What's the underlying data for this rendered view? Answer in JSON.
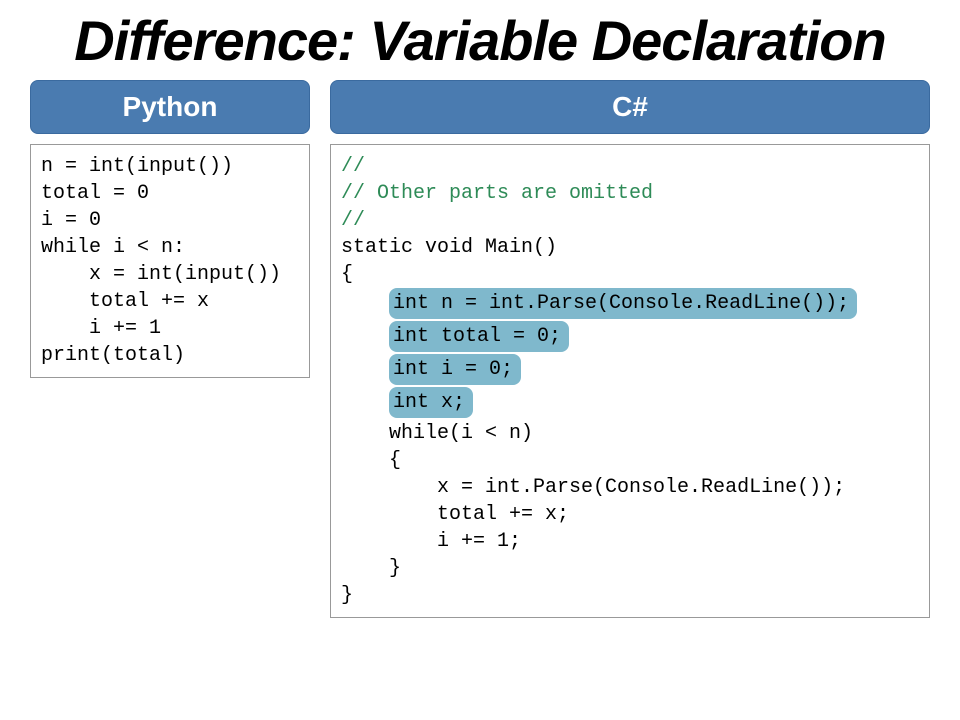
{
  "title": "Difference: Variable Declaration",
  "left": {
    "label": "Python",
    "code": "n = int(input())\ntotal = 0\ni = 0\nwhile i < n:\n    x = int(input())\n    total += x\n    i += 1\nprint(total)"
  },
  "right": {
    "label": "C#",
    "comment1": "//",
    "comment2": "// Other parts are omitted",
    "comment3": "//",
    "line_static": "static void Main()",
    "line_open": "{",
    "hl1": "int n = int.Parse(Console.ReadLine());",
    "hl2": "int total = 0;",
    "hl3": "int i = 0;",
    "hl4": "int x;",
    "line_while": "    while(i < n)",
    "line_whileopen": "    {",
    "line_x": "        x = int.Parse(Console.ReadLine());",
    "line_total": "        total += x;",
    "line_i": "        i += 1;",
    "line_whileclose": "    }",
    "line_close": "}"
  }
}
